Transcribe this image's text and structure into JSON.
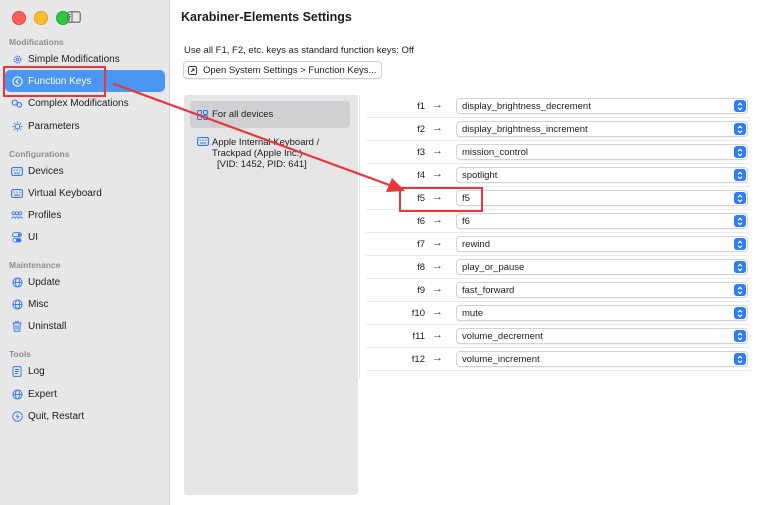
{
  "window": {
    "title": "Karabiner-Elements Settings"
  },
  "sidebar": {
    "sections": {
      "modifications": "Modifications",
      "configurations": "Configurations",
      "maintenance": "Maintenance",
      "tools": "Tools"
    },
    "items": [
      {
        "label": "Simple Modifications",
        "icon": "gear-icon"
      },
      {
        "label": "Function Keys",
        "icon": "function-keys-icon",
        "active": true
      },
      {
        "label": "Complex Modifications",
        "icon": "complex-gears-icon"
      },
      {
        "label": "Parameters",
        "icon": "sun-gear-icon"
      },
      {
        "label": "Devices",
        "icon": "keyboard-icon"
      },
      {
        "label": "Virtual Keyboard",
        "icon": "keyboard-icon"
      },
      {
        "label": "Profiles",
        "icon": "profiles-icon"
      },
      {
        "label": "UI",
        "icon": "toggle-icon"
      },
      {
        "label": "Update",
        "icon": "globe-icon"
      },
      {
        "label": "Misc",
        "icon": "globe-icon"
      },
      {
        "label": "Uninstall",
        "icon": "trash-icon"
      },
      {
        "label": "Log",
        "icon": "document-icon"
      },
      {
        "label": "Expert",
        "icon": "globe-icon"
      },
      {
        "label": "Quit, Restart",
        "icon": "power-icon"
      }
    ]
  },
  "main": {
    "fk_status": "Use all F1, F2, etc. keys as standard function keys:  Off",
    "open_button": "Open System Settings > Function Keys...",
    "devices": {
      "all_devices": "For all devices",
      "keyboard_line1": "Apple Internal Keyboard /",
      "keyboard_line2": "Trackpad (Apple Inc.)",
      "keyboard_line3": "[VID: 1452, PID: 641]"
    },
    "arrow_glyph": "→",
    "mappings": [
      {
        "key": "f1",
        "value": "display_brightness_decrement"
      },
      {
        "key": "f2",
        "value": "display_brightness_increment"
      },
      {
        "key": "f3",
        "value": "mission_control"
      },
      {
        "key": "f4",
        "value": "spotlight"
      },
      {
        "key": "f5",
        "value": "f5"
      },
      {
        "key": "f6",
        "value": "f6"
      },
      {
        "key": "f7",
        "value": "rewind"
      },
      {
        "key": "f8",
        "value": "play_or_pause"
      },
      {
        "key": "f9",
        "value": "fast_forward"
      },
      {
        "key": "f10",
        "value": "mute"
      },
      {
        "key": "f11",
        "value": "volume_decrement"
      },
      {
        "key": "f12",
        "value": "volume_increment"
      }
    ]
  },
  "colors": {
    "accent": "#4a96f2",
    "select_chevron": "#2f7cf6",
    "annotation": "#e8373b"
  }
}
